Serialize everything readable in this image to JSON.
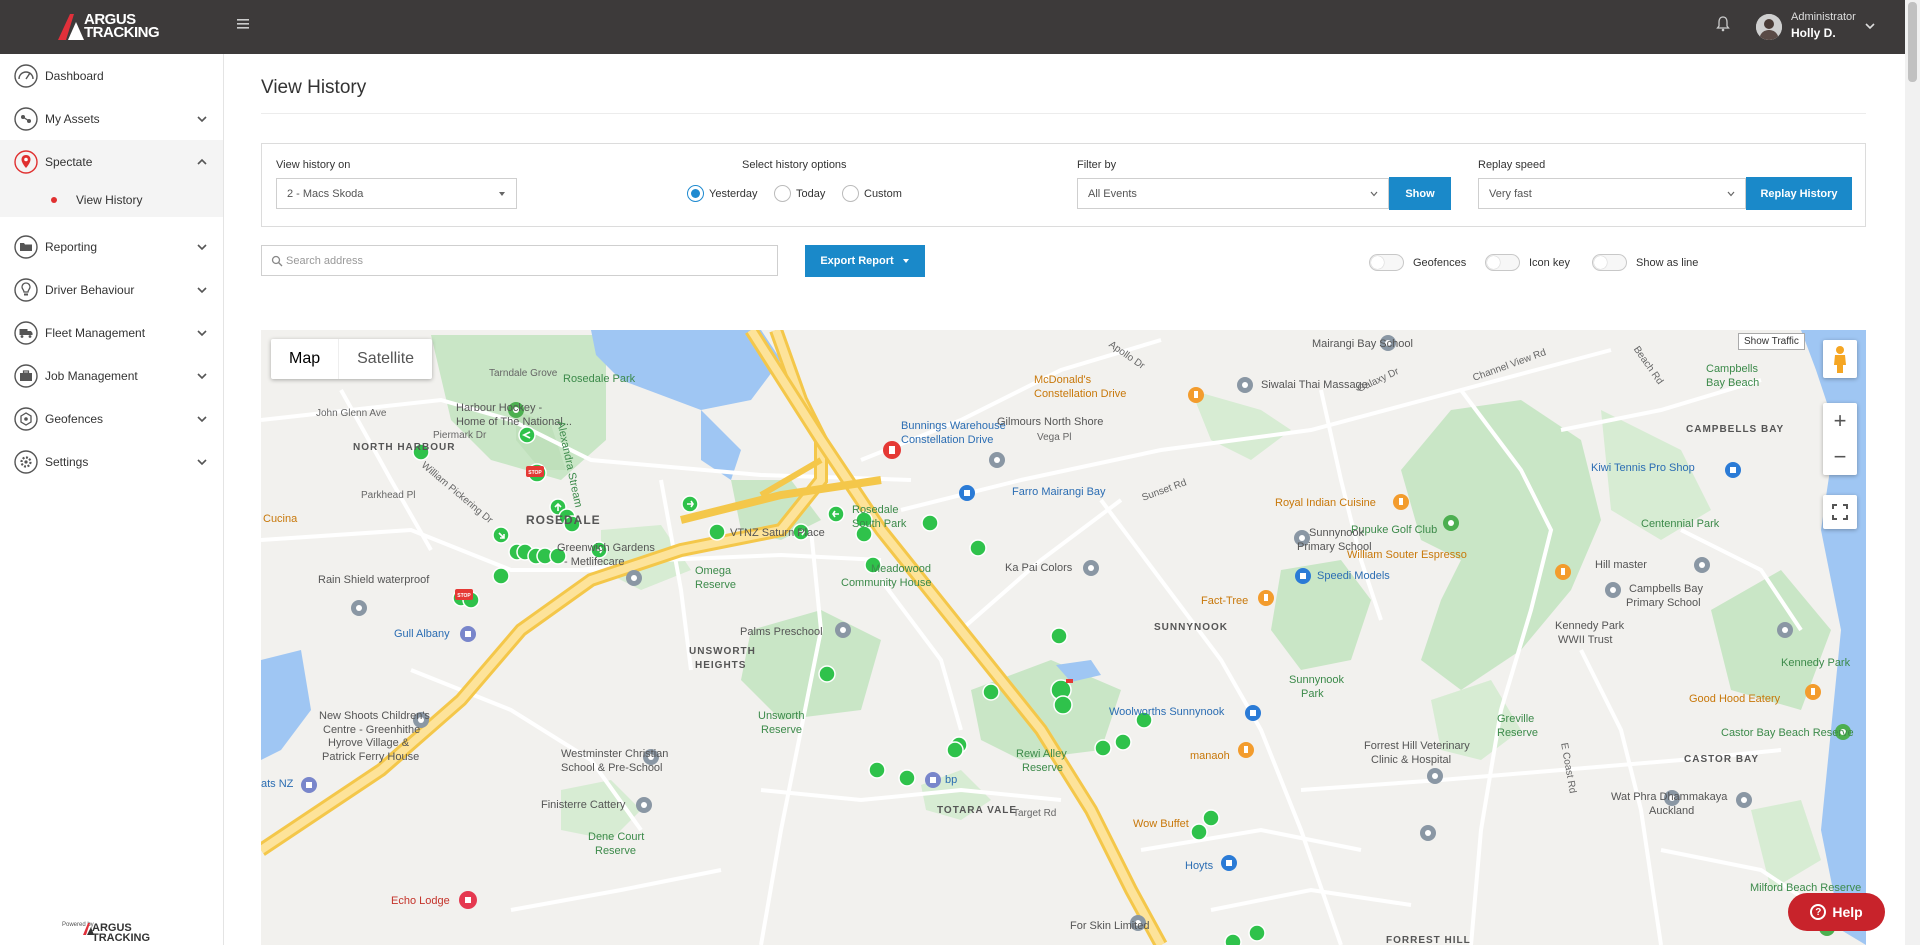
{
  "header": {
    "logo_line1": "ARGUS",
    "logo_line2": "TRACKING",
    "user_role": "Administrator",
    "user_name": "Holly D."
  },
  "sidebar": {
    "items": [
      {
        "label": "Dashboard",
        "icon": "gauge-icon"
      },
      {
        "label": "My Assets",
        "icon": "assets-icon"
      },
      {
        "label": "Spectate",
        "icon": "location-pin-icon"
      },
      {
        "label": "Reporting",
        "icon": "folder-icon"
      },
      {
        "label": "Driver Behaviour",
        "icon": "lightbulb-icon"
      },
      {
        "label": "Fleet Management",
        "icon": "truck-icon"
      },
      {
        "label": "Job Management",
        "icon": "briefcase-icon"
      },
      {
        "label": "Geofences",
        "icon": "geofence-icon"
      },
      {
        "label": "Settings",
        "icon": "gear-icon"
      }
    ],
    "sub_item": "View History",
    "powered_by": "Powered by",
    "powered_brand_1": "ARGUS",
    "powered_brand_2": "TRACKING"
  },
  "main": {
    "title": "View History",
    "view_history_label": "View history on",
    "asset_selected": "2 - Macs Skoda",
    "history_options_label": "Select history options",
    "history_options": [
      "Yesterday",
      "Today",
      "Custom"
    ],
    "history_selected": "Yesterday",
    "filter_label": "Filter by",
    "filter_selected": "All Events",
    "show_button": "Show",
    "replay_speed_label": "Replay speed",
    "replay_speed_selected": "Very fast",
    "replay_button": "Replay History",
    "search_placeholder": "Search address",
    "export_button": "Export Report",
    "toggles": [
      "Geofences",
      "Icon key",
      "Show as line"
    ]
  },
  "map": {
    "type_options": [
      "Map",
      "Satellite"
    ],
    "type_selected": "Map",
    "show_traffic": "Show Traffic",
    "zoom_in": "+",
    "zoom_out": "−",
    "labels": {
      "mairangi_bay_school": "Mairangi Bay School",
      "apollo_dr": "Apollo Dr",
      "channel_view_rd": "Channel View Rd",
      "beach_rd": "Beach Rd",
      "campbells_bay_beach_1": "Campbells",
      "campbells_bay_beach_2": "Bay Beach",
      "rosedale_park": "Rosedale Park",
      "harbour_hockey_1": "Harbour Hockey -",
      "harbour_hockey_2": "Home of The National...",
      "north_harbour": "NORTH HARBOUR",
      "tarndale_grove": "Tarndale Grove",
      "john_glenn_ave": "John Glenn Ave",
      "piermark_dr": "Piermark Dr",
      "alexandra_stream": "Alexandra Stream",
      "mcdonalds_1": "McDonald's",
      "mcdonalds_2": "Constellation Drive",
      "siwalai": "Siwalai Thai Massage",
      "galaxy_dr": "Galaxy Dr",
      "campbells_bay": "CAMPBELLS BAY",
      "bunnings_1": "Bunnings Warehouse",
      "bunnings_2": "Constellation Drive",
      "gilmours": "Gilmours North Shore",
      "vega_pl": "Vega Pl",
      "kiwi_tennis": "Kiwi Tennis Pro Shop",
      "farro": "Farro Mairangi Bay",
      "sunset_rd": "Sunset Rd",
      "royal_indian": "Royal Indian Cuisine",
      "pupuke": "Pupuke Golf Club",
      "centennial_park": "Centennial Park",
      "rosedale_south_1": "Rosedale",
      "rosedale_south_2": "South Park",
      "rosedale_area": "ROSEDALE",
      "cucina": "Cucina",
      "parkhead_pl": "Parkhead Pl",
      "william_pickering": "William Pickering Dr",
      "greenwich_1": "Greenwich Gardens",
      "greenwich_2": "- Metlifecare",
      "vtnz": "VTNZ Saturn Place",
      "sunnynook_primary_1": "Sunnynook",
      "sunnynook_primary_2": "Primary School",
      "william_souter": "William Souter Espresso",
      "hill_master": "Hill master",
      "meadowood_1": "Meadowood",
      "meadowood_2": "Community House",
      "omega_1": "Omega",
      "omega_2": "Reserve",
      "ka_pai": "Ka Pai Colors",
      "speedi": "Speedi Models",
      "campbells_primary_1": "Campbells Bay",
      "campbells_primary_2": "Primary School",
      "rain_shield": "Rain Shield waterproof",
      "fact_tree": "Fact-Tree",
      "gull": "Gull Albany",
      "palms": "Palms Preschool",
      "unsworth_heights_1": "UNSWORTH",
      "unsworth_heights_2": "HEIGHTS",
      "sunnynook_area": "SUNNYNOOK",
      "kennedy_park_1": "Kennedy Park",
      "kennedy_park_2": "WWII Trust",
      "kennedy_park": "Kennedy Park",
      "sunnynook_park_1": "Sunnynook",
      "sunnynook_park_2": "Park",
      "good_hood": "Good Hood Eatery",
      "new_shoots_1": "New Shoots Children's",
      "new_shoots_2": "Centre - Greenhithe",
      "greville_1": "Greville",
      "greville_2": "Reserve",
      "castor_bay_beach": "Castor Bay Beach Reserve",
      "hyrove_1": "Hyrove Village &",
      "hyrove_2": "Patrick Ferry House",
      "unsworth_reserve_1": "Unsworth",
      "unsworth_reserve_2": "Reserve",
      "woolworths": "Woolworths Sunnynook",
      "forrest_hill_vet_1": "Forrest Hill Veterinary",
      "forrest_hill_vet_2": "Clinic & Hospital",
      "castor_bay": "CASTOR BAY",
      "westminster_1": "Westminster Christian",
      "westminster_2": "School & Pre-School",
      "rewi_1": "Rewi Alley",
      "rewi_2": "Reserve",
      "manaoh": "manaoh",
      "wat_phra_1": "Wat Phra Dhammakaya",
      "wat_phra_2": "Auckland",
      "ats_nz": "ats NZ",
      "bp": "bp",
      "totara_vale": "TOTARA VALE",
      "target_rd": "Target Rd",
      "finisterre": "Finisterre Cattery",
      "wow_buffet": "Wow Buffet",
      "dene_court_1": "Dene Court",
      "dene_court_2": "Reserve",
      "hoyts": "Hoyts",
      "echo_lodge": "Echo Lodge",
      "for_skin": "For Skin Limited",
      "forrest_hill": "FORREST HILL",
      "milford_beach": "Milford Beach Reserve",
      "e_coast_rd": "E Coast Rd"
    }
  }
}
